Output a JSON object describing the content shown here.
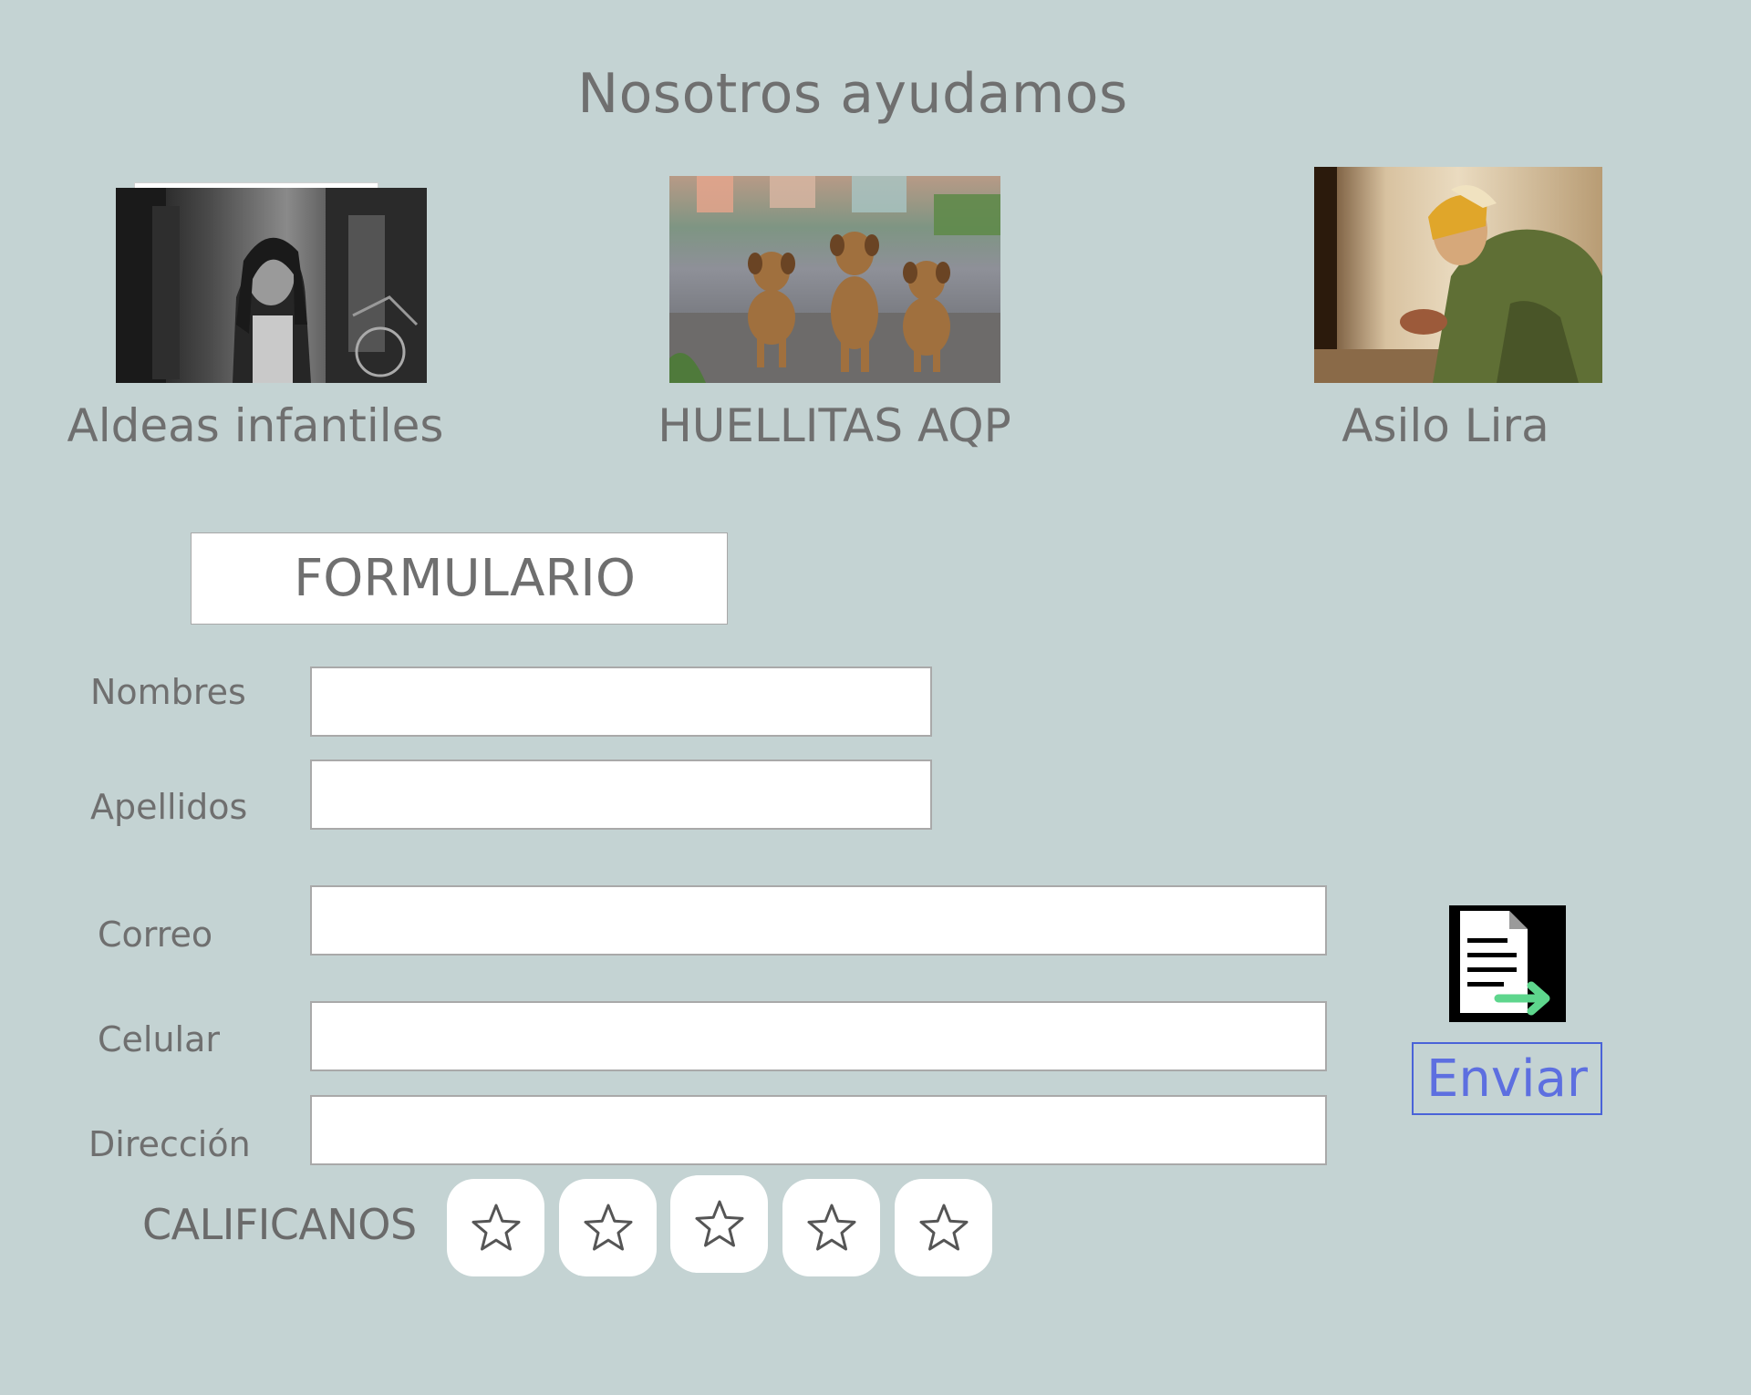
{
  "page_title": "Nosotros ayudamos",
  "organizations": [
    {
      "name": "Aldeas infantiles",
      "photo_icon": "girl-portrait-photo"
    },
    {
      "name": "HUELLITAS AQP",
      "photo_icon": "three-puppies-photo"
    },
    {
      "name": "Asilo Lira",
      "photo_icon": "elderly-man-photo"
    }
  ],
  "form": {
    "title": "FORMULARIO",
    "fields": {
      "nombres": {
        "label": "Nombres",
        "value": "",
        "placeholder": ""
      },
      "apellidos": {
        "label": "Apellidos",
        "value": "",
        "placeholder": ""
      },
      "correo": {
        "label": "Correo",
        "value": "",
        "placeholder": ""
      },
      "celular": {
        "label": "Celular",
        "value": "",
        "placeholder": ""
      },
      "direccion": {
        "label": "Dirección",
        "value": "",
        "placeholder": ""
      }
    },
    "send_icon": "document-send-icon",
    "send_label": "Enviar"
  },
  "rating": {
    "label": "CALIFICANOS",
    "max_stars": 5,
    "selected": 0,
    "star_icon": "star-outline-icon"
  },
  "colors": {
    "background": "#c4d3d3",
    "text": "#6f6f6f",
    "send_accent": "#5d6fe0",
    "arrow_green": "#5ed68d"
  }
}
